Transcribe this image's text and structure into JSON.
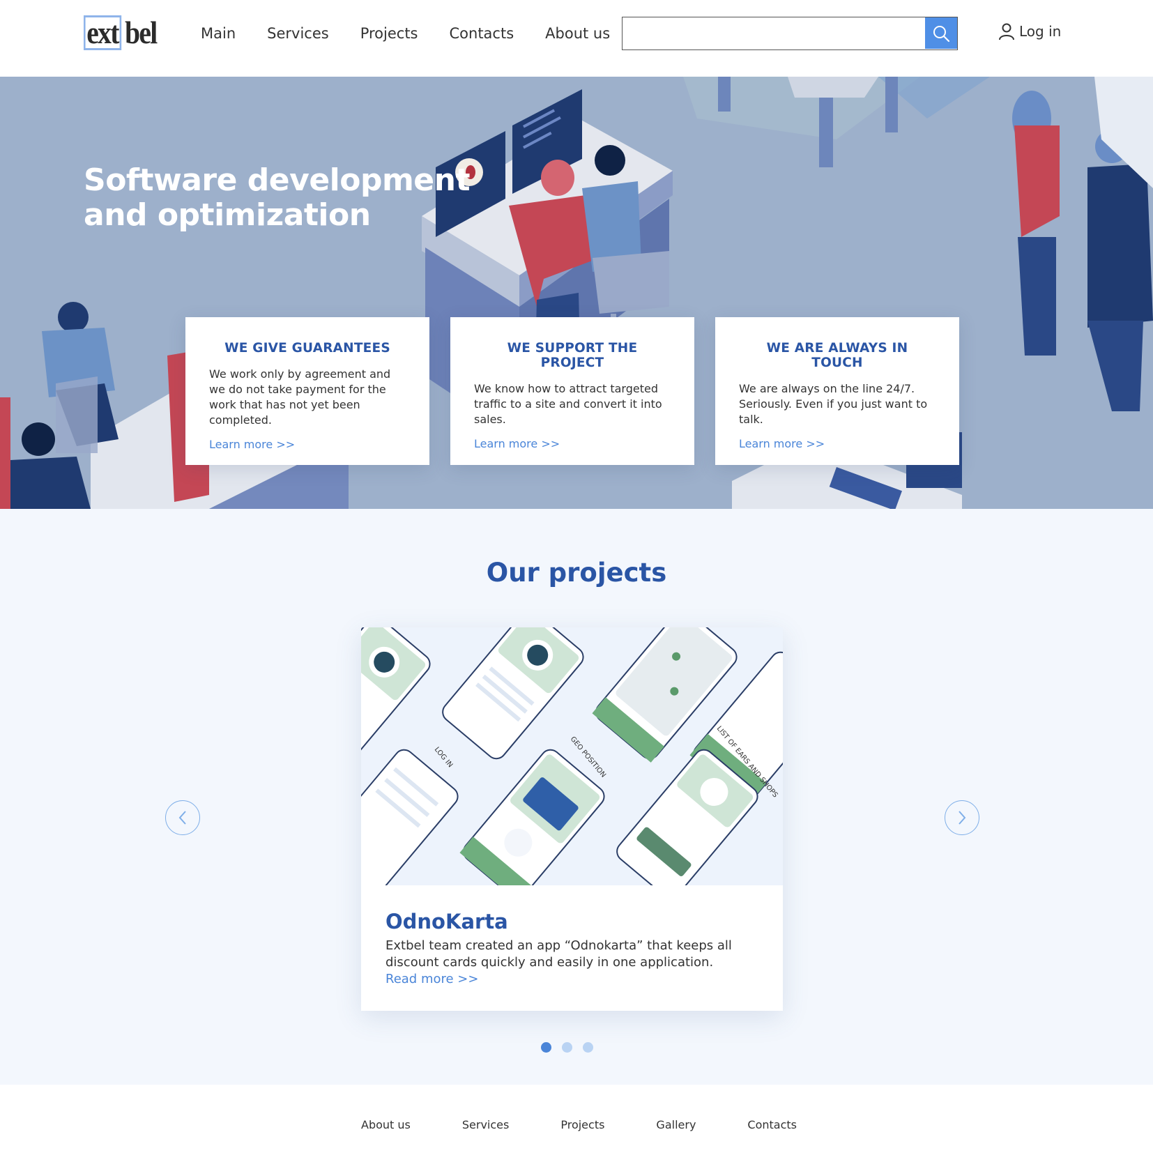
{
  "header": {
    "logo": {
      "part1": "ext",
      "part2": "bel"
    },
    "nav": [
      {
        "label": "Main"
      },
      {
        "label": "Services"
      },
      {
        "label": "Projects"
      },
      {
        "label": "Contacts"
      },
      {
        "label": "About us"
      }
    ],
    "search": {
      "value": "",
      "placeholder": "",
      "icon": "search-icon"
    },
    "login": {
      "label": "Log in",
      "icon": "user-icon"
    }
  },
  "hero": {
    "title": "Software development and optimization",
    "cards": [
      {
        "title": "WE GIVE GUARANTEES",
        "text": "We work only by agreement and we do not take payment for the work that has not yet been completed.",
        "link": "Learn more >>"
      },
      {
        "title": "WE SUPPORT THE PROJECT",
        "text": "We know how to attract targeted traffic to a site and convert it into sales.",
        "link": "Learn more >>"
      },
      {
        "title": "WE ARE ALWAYS IN TOUCH",
        "text": "We are always on the line 24/7. Seriously. Even if you just want to talk.",
        "link": "Learn more >>"
      }
    ]
  },
  "projects": {
    "title": "Our projects",
    "prev_icon": "chevron-left-icon",
    "next_icon": "chevron-right-icon",
    "image_labels": [
      "LOG IN",
      "GEO POSITION",
      "LIST OF EARS AND SHOPS"
    ],
    "card": {
      "title": "OdnoKarta",
      "text": "Extbel team created an app “Odnokarta” that keeps all discount cards quickly and easily in one application.",
      "link": "Read more >>"
    },
    "slides_total": 3,
    "active_slide": 1
  },
  "footer": {
    "nav": [
      {
        "label": "About us"
      },
      {
        "label": "Services"
      },
      {
        "label": "Projects"
      },
      {
        "label": "Gallery"
      },
      {
        "label": "Contacts"
      }
    ]
  },
  "colors": {
    "brand": "#2a55a5",
    "accent": "#4f8fe6",
    "link": "#4a85d8",
    "hero_bg": "#9db0cb"
  }
}
